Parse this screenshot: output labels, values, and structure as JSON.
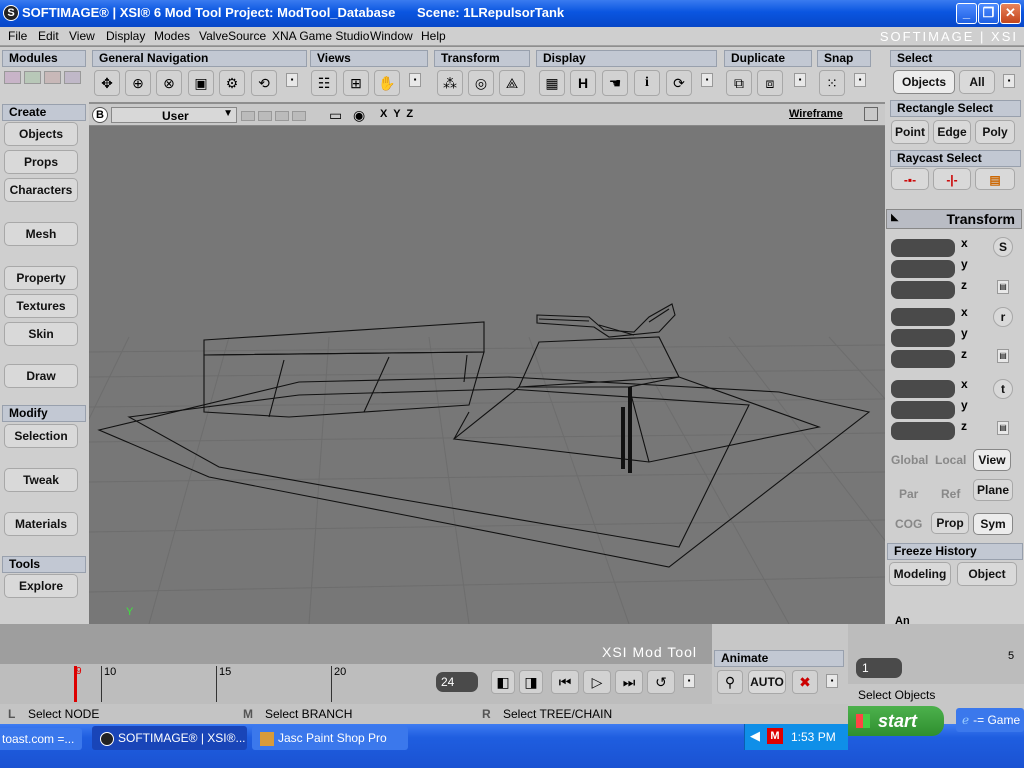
{
  "window": {
    "icon_letter": "S",
    "title": "SOFTIMAGE® | XSI® 6 Mod Tool Project: ModTool_Database      Scene: 1LRepulsorTank"
  },
  "menubar": {
    "items": [
      "File",
      "Edit",
      "View",
      "Display",
      "Modes",
      "ValveSource",
      "XNA Game Studio",
      "Window",
      "Help"
    ],
    "brand": "SOFTIMAGE | XSI"
  },
  "toolbar": {
    "sections": [
      "Modules",
      "General Navigation",
      "Views",
      "Transform",
      "Display",
      "Duplicate",
      "Snap"
    ],
    "display_h_label": "H",
    "display_i_label": "i"
  },
  "left_panel": {
    "create_header": "Create",
    "create_items": [
      "Objects",
      "Props",
      "Characters",
      "Mesh",
      "Property",
      "Textures",
      "Skin",
      "Draw"
    ],
    "modify_header": "Modify",
    "modify_items": [
      "Selection",
      "Tweak",
      "Materials"
    ],
    "tools_header": "Tools",
    "tools_items": [
      "Explore"
    ]
  },
  "viewport": {
    "b_label": "B",
    "camera": "User",
    "axes": "X Y Z",
    "mode": "Wireframe",
    "y_axis_label": "Y"
  },
  "right_panel": {
    "select_header": "Select",
    "select_buttons": [
      "Objects",
      "All"
    ],
    "rect_select_header": "Rectangle Select",
    "rect_buttons": [
      "Point",
      "Edge",
      "Poly"
    ],
    "raycast_header": "Raycast Select",
    "transform_header": "Transform",
    "axis_labels": [
      "x",
      "y",
      "z"
    ],
    "s_label": "S",
    "r_label": "r",
    "t_label": "t",
    "space_row1": [
      "Global",
      "Local",
      "View"
    ],
    "space_row2": [
      "Par",
      "Ref",
      "Plane"
    ],
    "space_row3": [
      "COG",
      "Prop",
      "Sym"
    ],
    "freeze_header": "Freeze History",
    "freeze_buttons": [
      "Modeling",
      "Object"
    ],
    "cut_label": "An"
  },
  "timeline": {
    "watermark": "XSI Mod Tool",
    "ticks": [
      "10",
      "15",
      "20"
    ],
    "current_frame": "9",
    "end_frame": "24",
    "animate_header": "Animate",
    "auto_label": "AUTO",
    "frame_field": "1",
    "right_tick": "5",
    "status": "Select Objects"
  },
  "mouse_hints": [
    {
      "key": "L",
      "text": "Select NODE"
    },
    {
      "key": "M",
      "text": "Select BRANCH"
    },
    {
      "key": "R",
      "text": "Select TREE/CHAIN"
    }
  ],
  "taskbar": {
    "start_label": "start",
    "items": [
      "toast.com =...",
      "SOFTIMAGE® | XSI®...",
      "Jasc Paint Shop Pro"
    ],
    "clock": "1:53 PM",
    "right_item": "-= Game"
  }
}
